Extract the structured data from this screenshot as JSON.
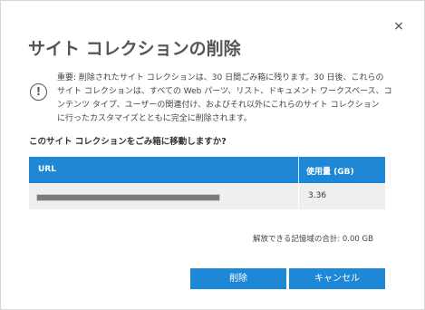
{
  "dialog": {
    "title": "サイト コレクションの削除",
    "close_icon": "×"
  },
  "notice": {
    "icon": "!",
    "lines": [
      "重要: 削除されたサイト コレクションは、30 日間ごみ箱に残ります。30 日後、これらの",
      "サイト コレクションは、すべての Web パーツ、リスト、ドキュメント ワークスペース、コ",
      "ンテンツ タイプ、ユーザーの関連付け、およびそれ以外にこれらのサイト コレクション",
      "に行ったカスタマイズとともに完全に削除されます。"
    ]
  },
  "question": "このサイト コレクションをごみ箱に移動しますか?",
  "table": {
    "columns": [
      "URL",
      "使用量 (GB)"
    ],
    "rows": [
      {
        "usage": "3.36"
      }
    ]
  },
  "total_label": "解放できる記憶域の合計: 0.00 GB",
  "buttons": {
    "delete": "削除",
    "cancel": "キャンセル"
  },
  "colors": {
    "accent": "#1e88d6",
    "row_bg": "#efefef"
  }
}
